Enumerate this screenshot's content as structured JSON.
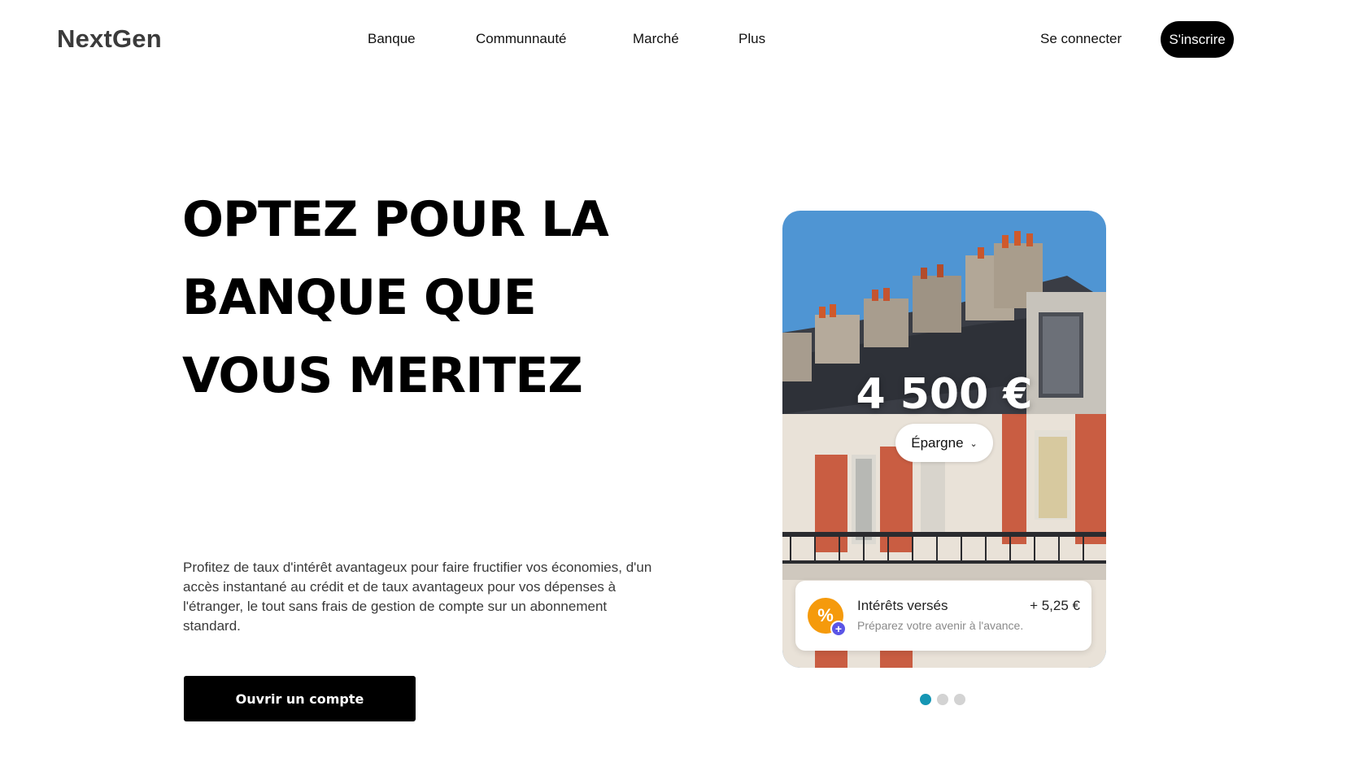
{
  "header": {
    "logo": "NextGen",
    "nav": [
      "Banque",
      "Communnauté",
      "Marché",
      "Plus"
    ],
    "login_label": "Se connecter",
    "signup_label": "S'inscrire"
  },
  "hero": {
    "title_lines": [
      "OPTEZ POUR LA",
      "BANQUE QUE",
      "VOUS MERITEZ"
    ],
    "description": "Profitez de taux d'intérêt avantageux pour faire fructifier vos économies, d'un accès instantané au crédit et de taux avantageux pour vos dépenses à l'étranger, le tout sans frais de gestion de compte sur un abonnement standard.",
    "cta_label": "Ouvrir un compte"
  },
  "card": {
    "amount": "4 500 €",
    "account_type": "Épargne",
    "info": {
      "icon": "percent-icon",
      "title": "Intérêts versés",
      "subtitle": "Préparez votre avenir à l'avance.",
      "amount": "+ 5,25 €"
    }
  },
  "carousel": {
    "total": 3,
    "active_index": 0,
    "active_color": "#1596b4",
    "inactive_color": "#d3d3d3"
  },
  "colors": {
    "accent_black": "#000000",
    "percent_badge": "#f59a0c",
    "plus_badge": "#5b55e6"
  }
}
